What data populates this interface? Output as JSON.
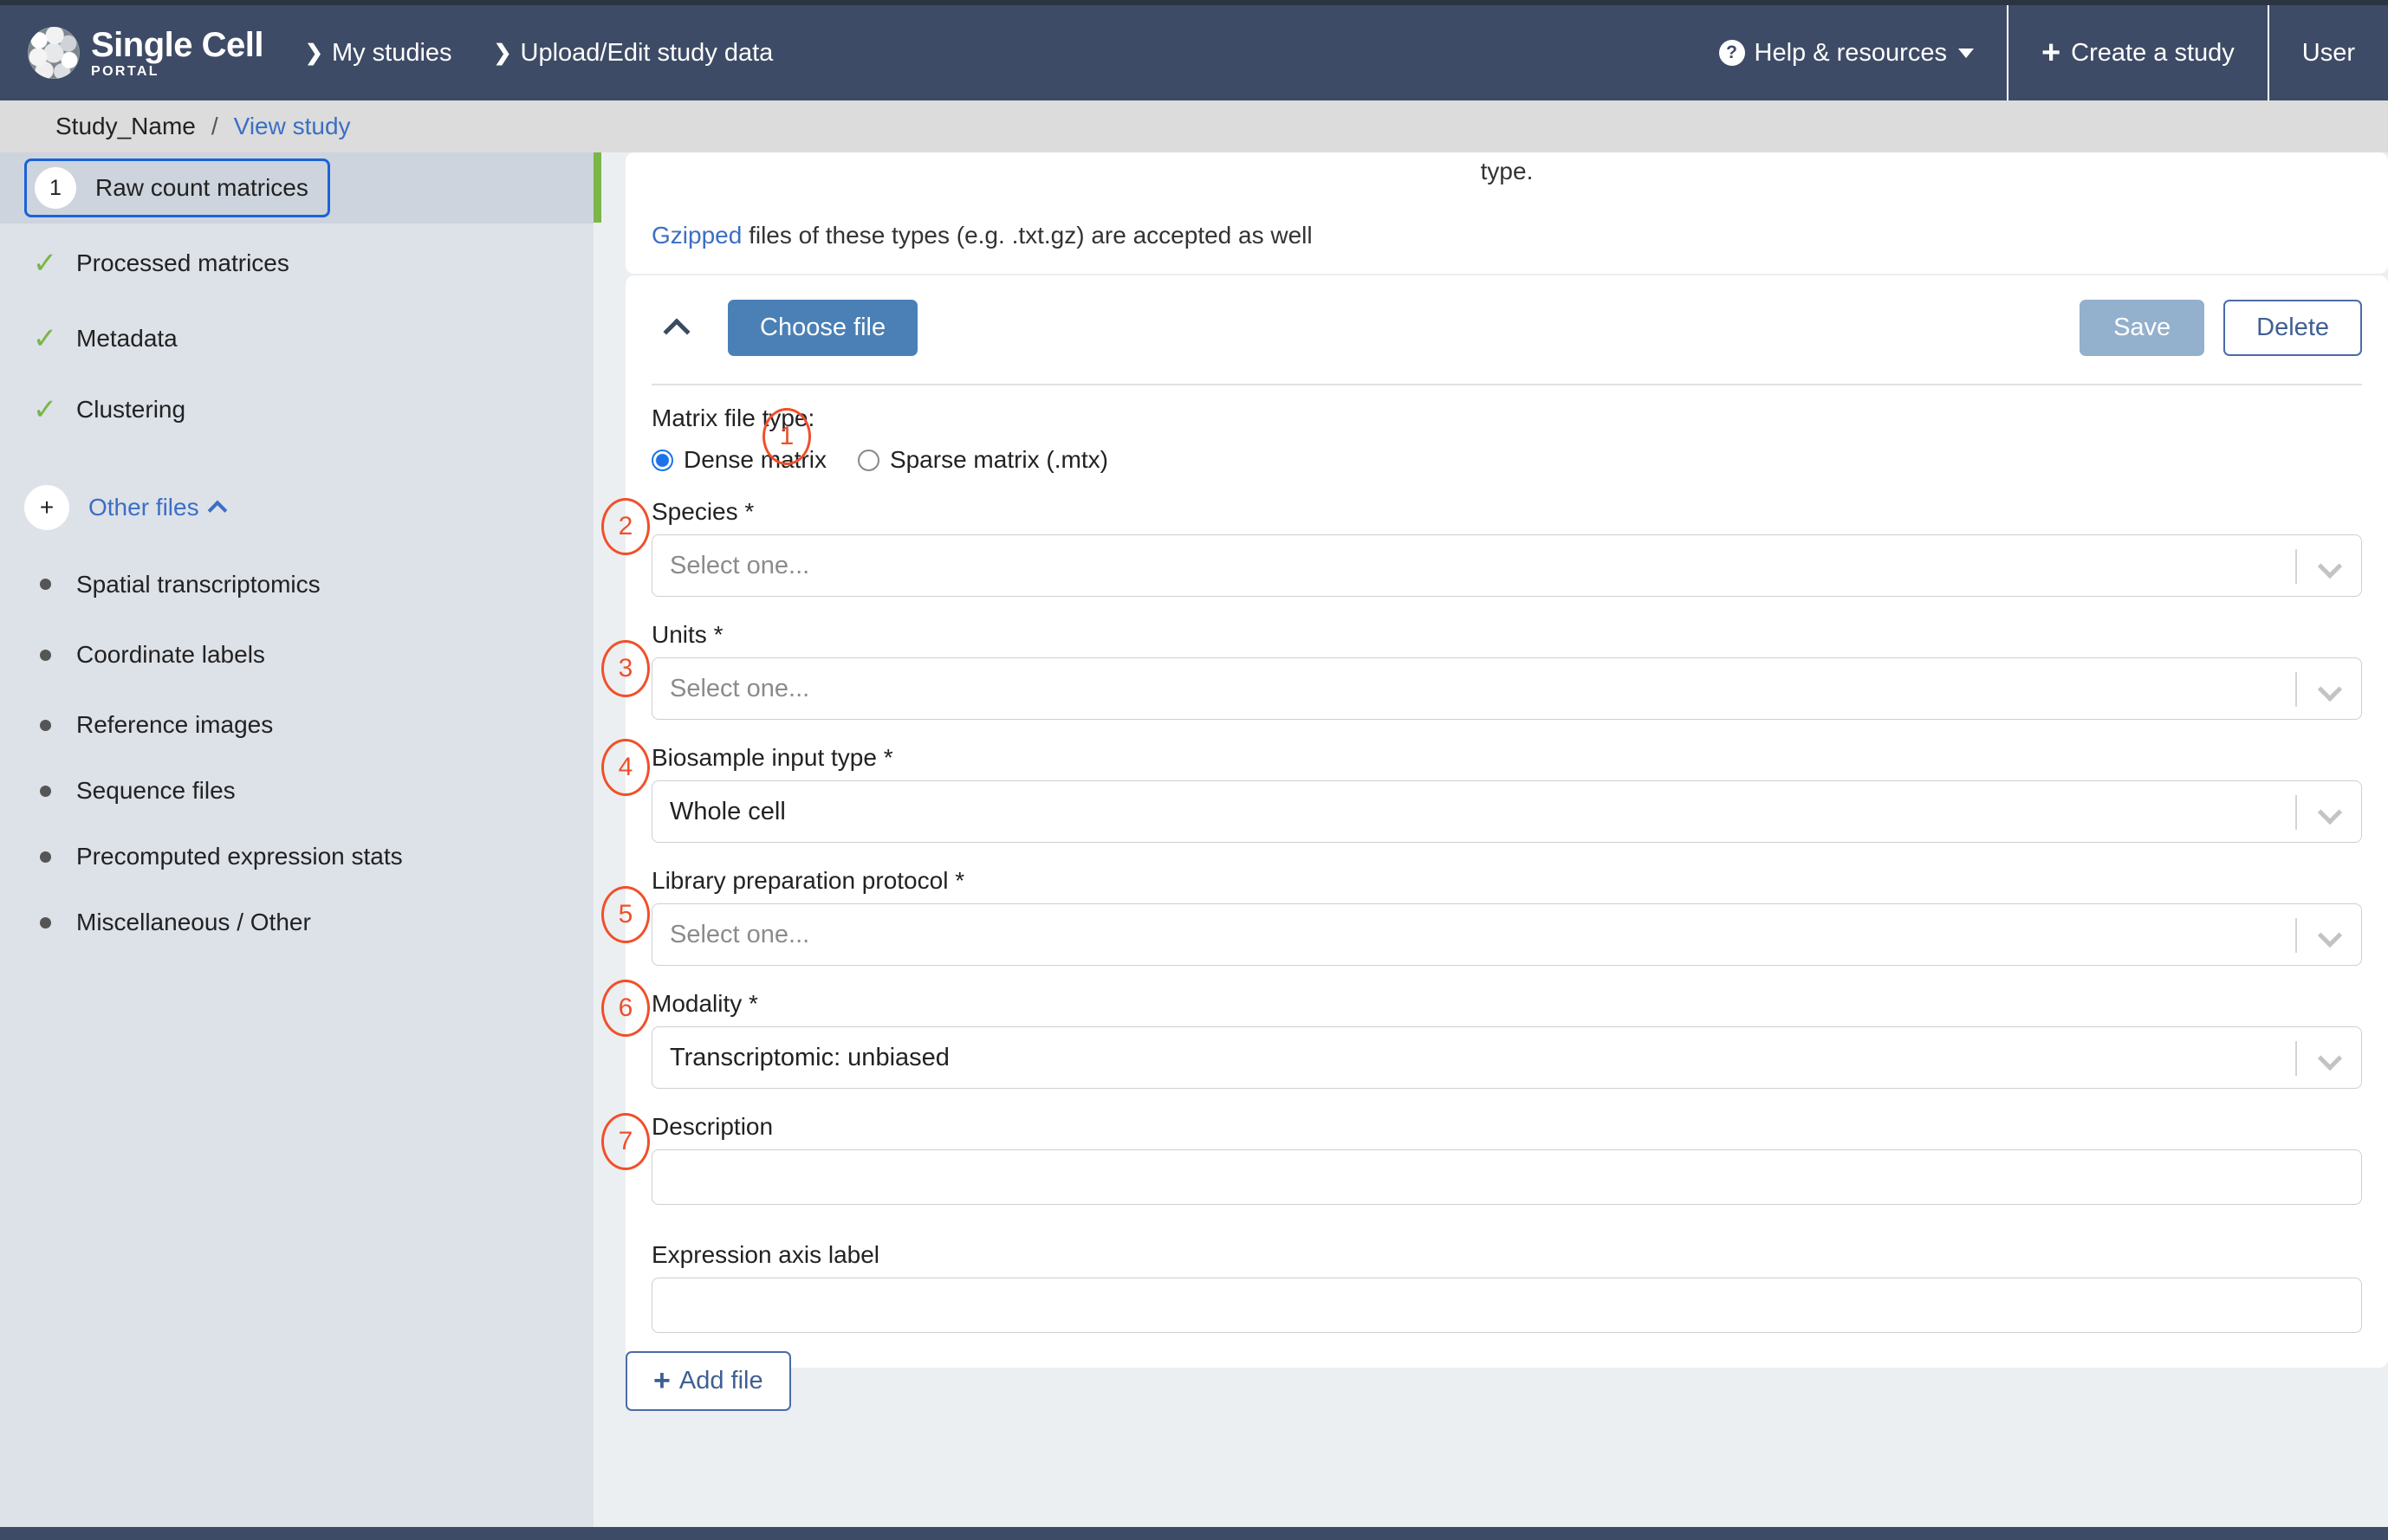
{
  "topnav": {
    "logo": {
      "title": "Single Cell",
      "subtitle": "PORTAL",
      "icon": "cell-sphere-icon"
    },
    "links": [
      {
        "label": "My studies",
        "icon": "chevron-right-icon"
      },
      {
        "label": "Upload/Edit study data",
        "icon": "chevron-right-icon"
      }
    ],
    "right": [
      {
        "label": "Help & resources",
        "icon": "question-circle-icon",
        "caret": "chevron-down-icon"
      },
      {
        "label": "Create a study",
        "icon": "plus-icon"
      },
      {
        "label": "User"
      }
    ]
  },
  "breadcrumb": {
    "study": "Study_Name",
    "separator": "/",
    "link": "View study"
  },
  "sidebar": {
    "steps": [
      {
        "label": "Raw count matrices",
        "badge": "1",
        "state": "active"
      },
      {
        "label": "Processed matrices",
        "badge": "check",
        "state": "done"
      },
      {
        "label": "Metadata",
        "badge": "check",
        "state": "done"
      },
      {
        "label": "Clustering",
        "badge": "check",
        "state": "done"
      }
    ],
    "other_files": {
      "label": "Other files",
      "plus": "+",
      "chevron": "chevron-up-icon"
    },
    "other_items": [
      {
        "label": "Spatial transcriptomics"
      },
      {
        "label": "Coordinate labels"
      },
      {
        "label": "Reference images"
      },
      {
        "label": "Sequence files"
      },
      {
        "label": "Precomputed expression stats"
      },
      {
        "label": "Miscellaneous / Other"
      }
    ]
  },
  "main": {
    "intro": {
      "fragment": "type.",
      "gzipped_link": "Gzipped",
      "gzipped_rest": " files of these types (e.g. .txt.gz) are accepted as well"
    },
    "form": {
      "collapse_icon": "chevron-up-icon",
      "choose_file_label": "Choose file",
      "save_label": "Save",
      "delete_label": "Delete",
      "matrix_file_type_label": "Matrix file type:",
      "radios": [
        {
          "label": "Dense matrix",
          "selected": true
        },
        {
          "label": "Sparse matrix (.mtx)",
          "selected": false
        }
      ],
      "fields": [
        {
          "label": "Species *",
          "value": "",
          "placeholder": "Select one...",
          "kind": "select",
          "marker": "2"
        },
        {
          "label": "Units *",
          "value": "",
          "placeholder": "Select one...",
          "kind": "select",
          "marker": "3"
        },
        {
          "label": "Biosample input type *",
          "value": "Whole cell",
          "placeholder": "",
          "kind": "select",
          "marker": "4"
        },
        {
          "label": "Library preparation protocol *",
          "value": "",
          "placeholder": "Select one...",
          "kind": "select",
          "marker": "5"
        },
        {
          "label": "Modality *",
          "value": "Transcriptomic: unbiased",
          "placeholder": "",
          "kind": "select",
          "marker": "6"
        },
        {
          "label": "Description",
          "value": "",
          "placeholder": "",
          "kind": "text",
          "marker": "7"
        },
        {
          "label": "Expression axis label",
          "value": "",
          "placeholder": "",
          "kind": "text",
          "marker": ""
        }
      ],
      "matrix_marker": "1"
    },
    "add_file_label": "Add file",
    "add_file_icon": "plus-icon"
  },
  "colors": {
    "navbar": "#3e4b66",
    "breadcrumb_bg": "#dcdcdc",
    "sidebar_bg": "#dde1e8",
    "sidebar_active_bg": "#cdd4de",
    "green_accent": "#7ab648",
    "primary_button": "#4a80b5",
    "save_button": "#93b0cd",
    "link_blue": "#3b6fc4",
    "marker_orange": "#f0502a",
    "radio_blue": "#1a73e8",
    "focus_blue": "#1a63d8"
  }
}
